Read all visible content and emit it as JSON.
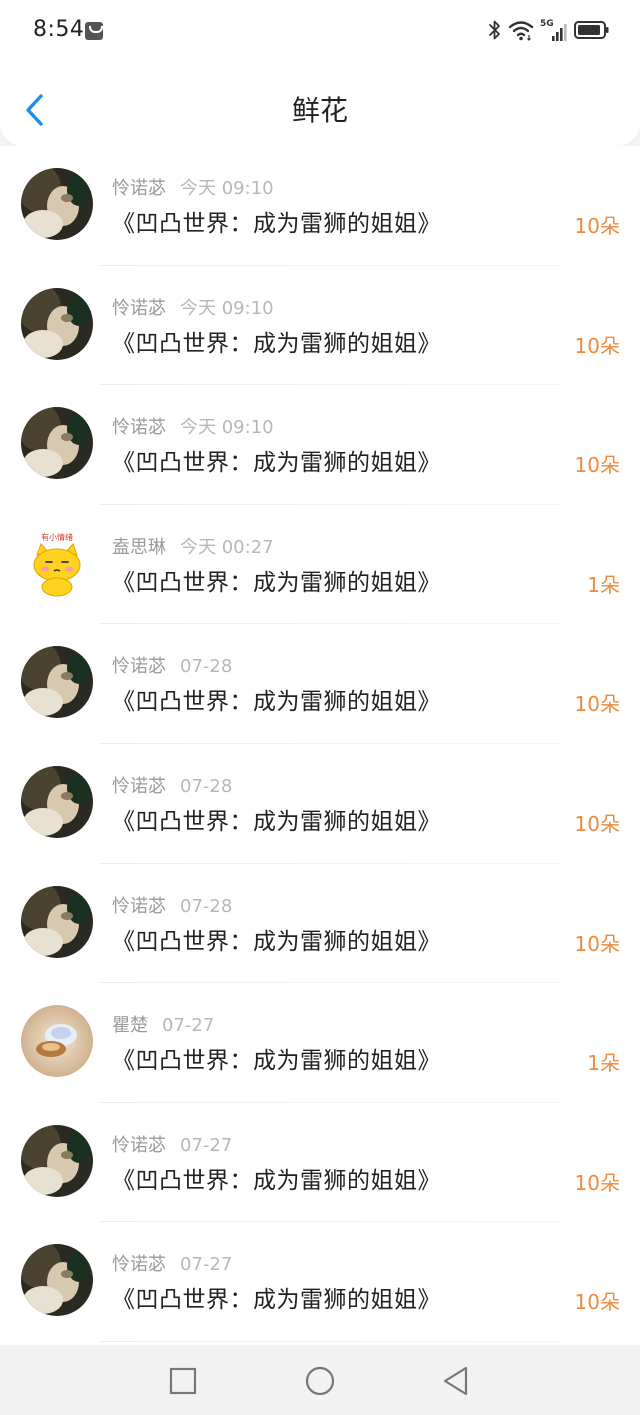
{
  "status_bar": {
    "time": "8:54",
    "network": "5G",
    "icons": [
      "message-icon",
      "bluetooth-icon",
      "wifi-icon",
      "signal-icon",
      "battery-icon"
    ]
  },
  "header": {
    "title": "鲜花",
    "back_icon": "chevron-left-icon"
  },
  "colors": {
    "accent": "#1e8fe8",
    "amount": "#f08a3c"
  },
  "records": [
    {
      "user": "怜诺苾",
      "time": "今天 09:10",
      "book": "《凹凸世界：成为雷狮的姐姐》",
      "amount": "10朵",
      "avatar": "portrait"
    },
    {
      "user": "怜诺苾",
      "time": "今天 09:10",
      "book": "《凹凸世界：成为雷狮的姐姐》",
      "amount": "10朵",
      "avatar": "portrait"
    },
    {
      "user": "怜诺苾",
      "time": "今天 09:10",
      "book": "《凹凸世界：成为雷狮的姐姐》",
      "amount": "10朵",
      "avatar": "portrait"
    },
    {
      "user": "盍思琳",
      "time": "今天 00:27",
      "book": "《凹凸世界：成为雷狮的姐姐》",
      "amount": "1朵",
      "avatar": "cartoon-cat"
    },
    {
      "user": "怜诺苾",
      "time": "07-28",
      "book": "《凹凸世界：成为雷狮的姐姐》",
      "amount": "10朵",
      "avatar": "portrait"
    },
    {
      "user": "怜诺苾",
      "time": "07-28",
      "book": "《凹凸世界：成为雷狮的姐姐》",
      "amount": "10朵",
      "avatar": "portrait"
    },
    {
      "user": "怜诺苾",
      "time": "07-28",
      "book": "《凹凸世界：成为雷狮的姐姐》",
      "amount": "10朵",
      "avatar": "portrait"
    },
    {
      "user": "瞿楚",
      "time": "07-27",
      "book": "《凹凸世界：成为雷狮的姐姐》",
      "amount": "1朵",
      "avatar": "shell"
    },
    {
      "user": "怜诺苾",
      "time": "07-27",
      "book": "《凹凸世界：成为雷狮的姐姐》",
      "amount": "10朵",
      "avatar": "portrait"
    },
    {
      "user": "怜诺苾",
      "time": "07-27",
      "book": "《凹凸世界：成为雷狮的姐姐》",
      "amount": "10朵",
      "avatar": "portrait"
    }
  ],
  "nav_bar": {
    "buttons": [
      "recent-apps-icon",
      "home-icon",
      "back-icon"
    ]
  }
}
